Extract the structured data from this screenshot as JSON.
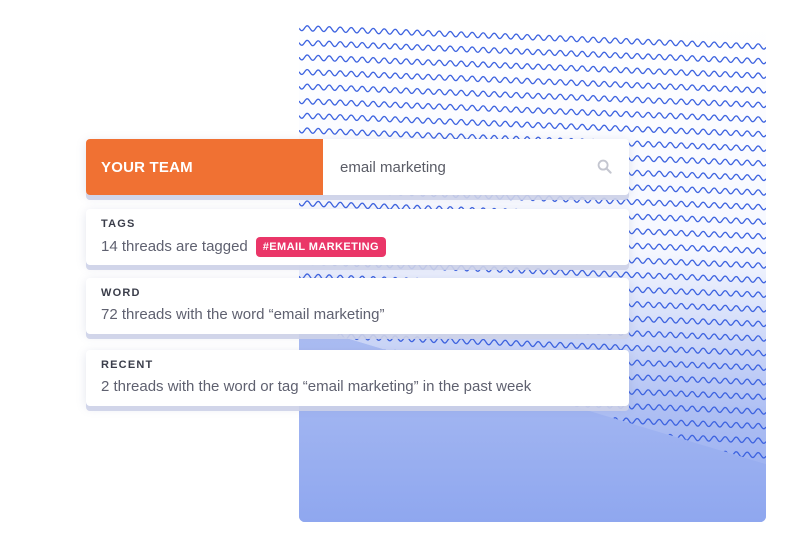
{
  "search": {
    "team_label": "YOUR TEAM",
    "query": "email marketing"
  },
  "results": [
    {
      "title": "TAGS",
      "text": "14 threads are tagged",
      "tag": "#EMAIL MARKETING"
    },
    {
      "title": "WORD",
      "text": "72 threads with the word “email marketing”"
    },
    {
      "title": "RECENT",
      "text": "2 threads with the word or tag “email marketing” in the past week"
    }
  ],
  "colors": {
    "team_bg": "#f07133",
    "tag_bg": "#ea3668",
    "wave": "#3d63e0",
    "panel_bottom": "#8fa7ef"
  },
  "icons": {
    "search": "search-icon",
    "decoration": "wave-pattern"
  }
}
